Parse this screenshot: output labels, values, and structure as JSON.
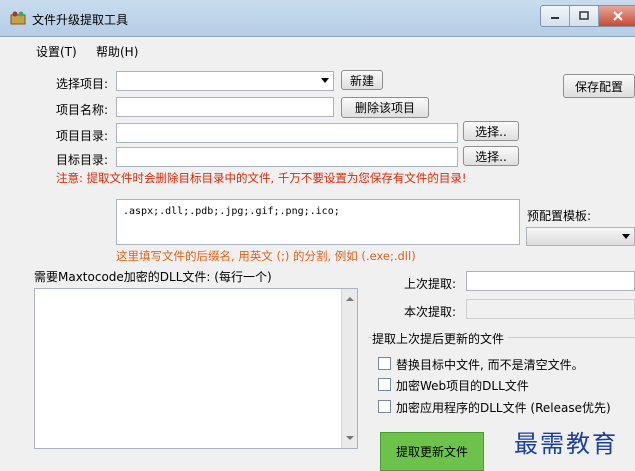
{
  "window": {
    "title": "文件升级提取工具"
  },
  "menu": {
    "settings": "设置(T)",
    "help": "帮助(H)"
  },
  "project": {
    "select_label": "选择项目:",
    "new_button": "新建",
    "save_config_button": "保存配置",
    "name_label": "项目名称:",
    "delete_button": "删除该项目",
    "dir_label": "项目目录:",
    "target_dir_label": "目标目录:",
    "browse_button": "选择..",
    "browse_button_2": "选择.."
  },
  "warning": "注意: 提取文件时会删除目标目录中的文件, 千万不要设置为您保存有文件的目录!",
  "extensions": {
    "value": ".aspx;.dll;.pdb;.jpg;.gif;.png;.ico;",
    "hint": "这里填写文件的后缀名, 用英文 (;) 的分割, 例如 (.exe;.dll)"
  },
  "preset": {
    "label": "预配置模板:"
  },
  "dll_section": {
    "label": "需要Maxtocode加密的DLL文件: (每行一个)"
  },
  "extract_times": {
    "last_label": "上次提取:",
    "this_label": "本次提取:"
  },
  "options": {
    "group_title": "提取上次提后更新的文件",
    "replace_label": "替换目标中文件, 而不是清空文件。",
    "encrypt_web_label": "加密Web项目的DLL文件",
    "encrypt_app_label": "加密应用程序的DLL文件 (Release优先)"
  },
  "action": {
    "extract_button": "提取更新文件"
  },
  "watermark": "最需教育",
  "colors": {
    "warning": "#d82a0a",
    "hint": "#e0621a",
    "action": "#6cc24a"
  }
}
